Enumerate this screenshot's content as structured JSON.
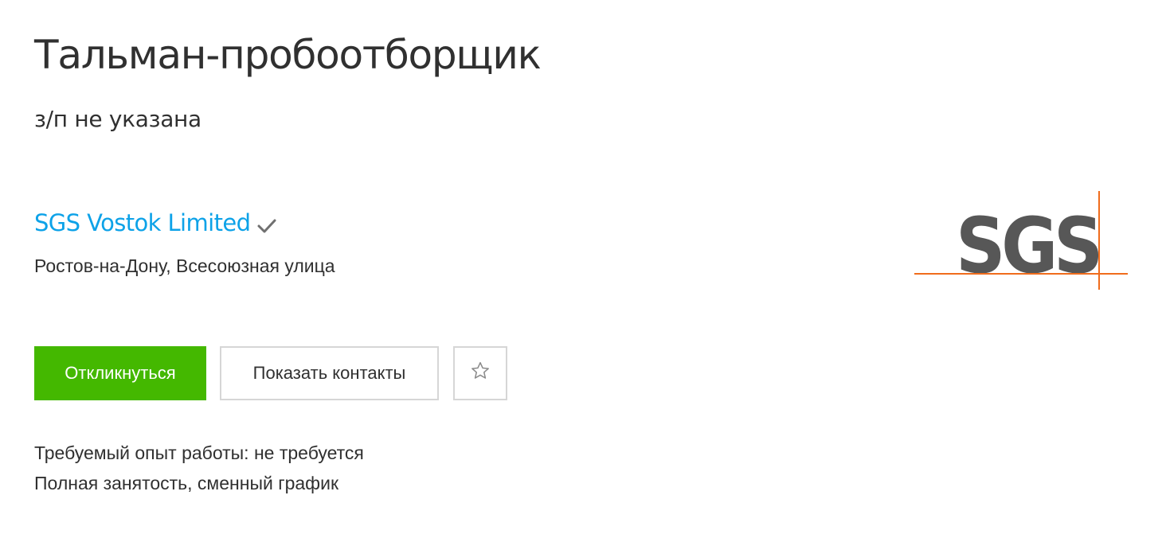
{
  "vacancy": {
    "title": "Тальман-пробоотборщик",
    "salary": "з/п не указана"
  },
  "employer": {
    "name": "SGS Vostok Limited",
    "verified_icon": "checkmark-icon",
    "address": "Ростов-на-Дону, Всесоюзная улица",
    "logo": {
      "text": "SGS",
      "text_color": "#575757",
      "line_color": "#f06c1c"
    }
  },
  "actions": {
    "apply_label": "Откликнуться",
    "contacts_label": "Показать контакты",
    "favorite_icon": "star-outline-icon"
  },
  "details": {
    "experience": "Требуемый опыт работы: не требуется",
    "employment": "Полная занятость, сменный график"
  },
  "colors": {
    "accent_green": "#44b800",
    "link_blue": "#0da2e8",
    "text": "#303030",
    "border": "#d6d6d6"
  }
}
